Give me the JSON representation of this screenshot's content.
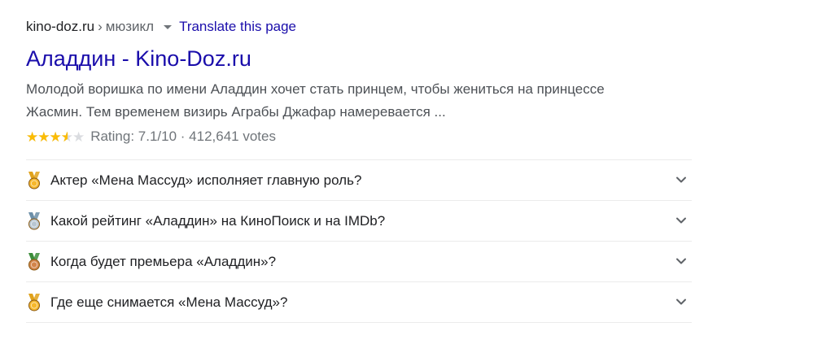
{
  "breadcrumb": {
    "domain": "kino-doz.ru",
    "separator": "›",
    "path": "мюзикл",
    "translate_label": "Translate this page"
  },
  "result": {
    "title": "Аладдин - Kino-Doz.ru",
    "snippet_lines": [
      "Молодой воришка по имени Аладдин хочет стать принцем, чтобы жениться на принцессе",
      "Жасмин. Тем временем визирь Аграбы Джафар намеревается ..."
    ],
    "rating": {
      "stars_glyphs": "★★★★★",
      "fill_fraction": 0.71,
      "text": "Rating: 7.1/10 · 412,641 votes"
    }
  },
  "faq": {
    "questions": [
      {
        "text": "Актер «Мена Массуд» исполняет главную роль?",
        "medal_icon": "gold-medal-icon",
        "ribbon_color": "#e0a21b",
        "disk_color": "#f6b72b"
      },
      {
        "text": "Какой рейтинг «Аладдин» на КиноПоиск и на IMDb?",
        "medal_icon": "silver-medal-icon",
        "ribbon_color": "#6d8fa8",
        "disk_color": "#b8c6d1"
      },
      {
        "text": "Когда будет премьера «Аладдин»?",
        "medal_icon": "bronze-medal-icon",
        "ribbon_color": "#3c8d3a",
        "disk_color": "#d2844a"
      },
      {
        "text": "Где еще снимается «Мена Массуд»?",
        "medal_icon": "gold-medal-icon",
        "ribbon_color": "#e0a21b",
        "disk_color": "#f6b72b"
      }
    ]
  },
  "colors": {
    "link": "#1a0dab",
    "star_filled": "#fbbc04",
    "star_empty": "#dadce0"
  }
}
